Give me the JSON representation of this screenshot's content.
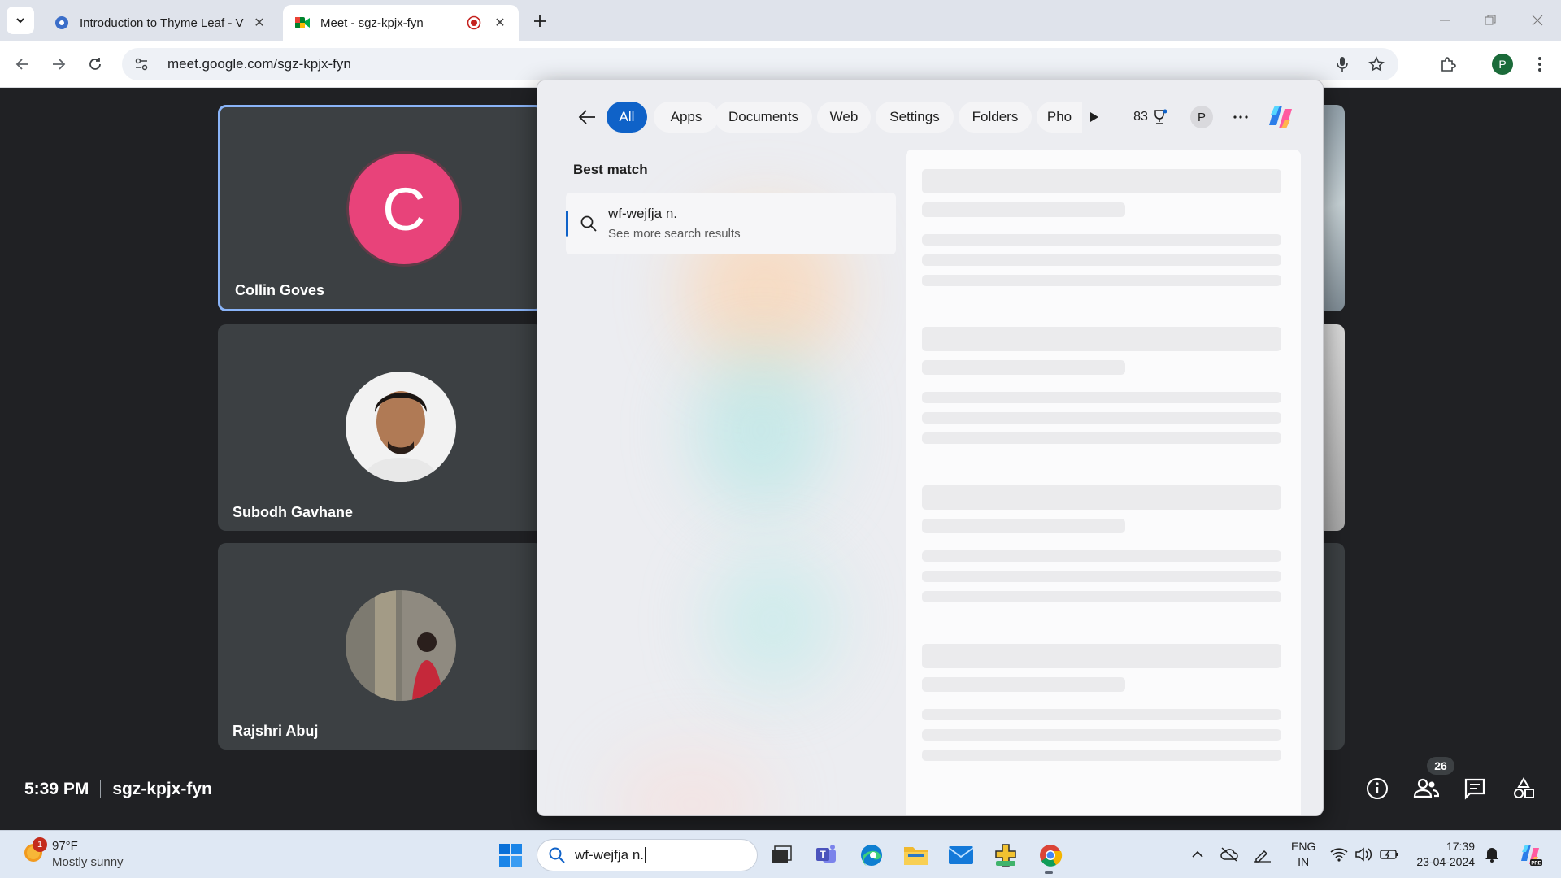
{
  "browser": {
    "tabs": [
      {
        "title": "Introduction to Thyme Leaf - V",
        "active": false
      },
      {
        "title": "Meet - sgz-kpjx-fyn",
        "active": true
      }
    ],
    "url": "meet.google.com/sgz-kpjx-fyn",
    "profile_initial": "P"
  },
  "meet": {
    "participants": [
      {
        "name": "Collin Goves",
        "avatar_letter": "C",
        "avatar_color": "#e8437a"
      },
      {
        "name": "Subodh Gavhane"
      },
      {
        "name": "Rajshri Abuj"
      }
    ],
    "time": "5:39 PM",
    "meeting_code": "sgz-kpjx-fyn",
    "people_count": "26"
  },
  "search": {
    "pivots": [
      {
        "label": "All",
        "selected": true
      },
      {
        "label": "Apps"
      },
      {
        "label": "Documents"
      },
      {
        "label": "Web"
      },
      {
        "label": "Settings"
      },
      {
        "label": "Folders"
      },
      {
        "label": "Pho"
      }
    ],
    "rewards_points": "83",
    "account_initial": "P",
    "best_match_heading": "Best match",
    "result_title": "wf-wejfja n.",
    "result_subtitle": "See more search results",
    "accent_color": "#0f62c8"
  },
  "taskbar": {
    "weather_badge": "1",
    "temperature": "97°F",
    "condition": "Mostly sunny",
    "search_text": "wf-wejfja n.",
    "lang_line1": "ENG",
    "lang_line2": "IN",
    "time": "17:39",
    "date": "23-04-2024"
  }
}
